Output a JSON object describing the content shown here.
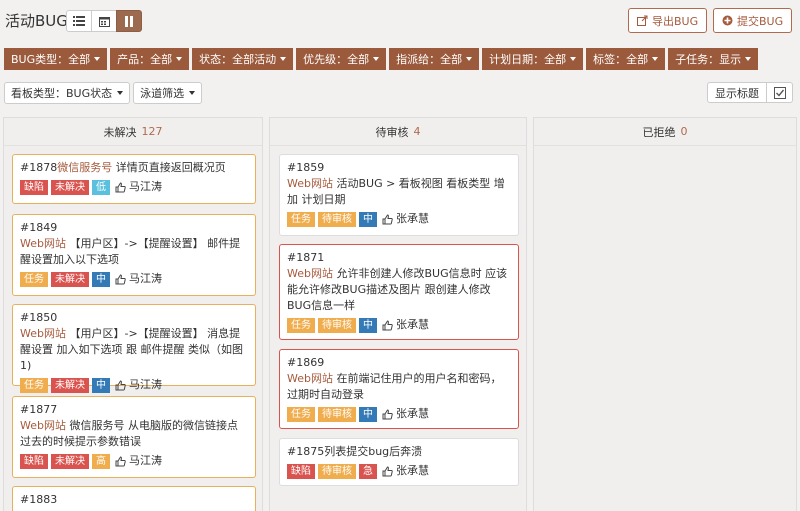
{
  "page": {
    "title": "活动BUG"
  },
  "header": {
    "export_label": "导出BUG",
    "submit_label": "提交BUG"
  },
  "filters": [
    "BUG类型：全部",
    "产品：全部",
    "状态：全部活动",
    "优先级：全部",
    "指派给：全部",
    "计划日期：全部",
    "标签：全部",
    "子任务：显示"
  ],
  "subbar": {
    "board_type": "看板类型：BUG状态",
    "lane_filter": "泳道筛选",
    "show_title": "显示标题"
  },
  "columns": [
    {
      "title": "未解决",
      "count": "127",
      "cards": [
        {
          "id": "#1878",
          "product": "微信服务号",
          "text": " 详情页直接返回概况页",
          "tags": [
            {
              "t": "缺陷",
              "c": "t-bug"
            },
            {
              "t": "未解决",
              "c": "t-open"
            },
            {
              "t": "低",
              "c": "t-low"
            }
          ],
          "owner": "马江涛"
        },
        {
          "id": "#1849",
          "product": "Web网站",
          "text": " 【用户区】->【提醒设置】 邮件提醒设置加入以下选项",
          "tags": [
            {
              "t": "任务",
              "c": "t-task"
            },
            {
              "t": "未解决",
              "c": "t-open"
            },
            {
              "t": "中",
              "c": "t-mid"
            }
          ],
          "owner": "马江涛"
        },
        {
          "id": "#1850",
          "product": "Web网站",
          "text": " 【用户区】->【提醒设置】 消息提醒设置 加入如下选项 跟 邮件提醒 类似（如图1)",
          "tags": [
            {
              "t": "任务",
              "c": "t-task"
            },
            {
              "t": "未解决",
              "c": "t-open"
            },
            {
              "t": "中",
              "c": "t-mid"
            }
          ],
          "owner": "马江涛"
        },
        {
          "id": "#1877",
          "product": "Web网站",
          "text": " 微信服务号 从电脑版的微信链接点过去的时候提示参数错误",
          "tags": [
            {
              "t": "缺陷",
              "c": "t-bug"
            },
            {
              "t": "未解决",
              "c": "t-open"
            },
            {
              "t": "高",
              "c": "t-high"
            }
          ],
          "owner": "马江涛"
        },
        {
          "id": "#1883"
        }
      ]
    },
    {
      "title": "待审核",
      "count": "4",
      "cards": [
        {
          "id": "#1859",
          "product": "Web网站",
          "text": " 活动BUG > 看板视图 看板类型 增加 计划日期",
          "tags": [
            {
              "t": "任务",
              "c": "t-task"
            },
            {
              "t": "待审核",
              "c": "t-review"
            },
            {
              "t": "中",
              "c": "t-mid"
            }
          ],
          "owner": "张承慧"
        },
        {
          "id": "#1871",
          "product": "Web网站",
          "text": " 允许非创建人修改BUG信息时 应该能允许修改BUG描述及图片 跟创建人修改BUG信息一样",
          "tags": [
            {
              "t": "任务",
              "c": "t-task"
            },
            {
              "t": "待审核",
              "c": "t-review"
            },
            {
              "t": "中",
              "c": "t-mid"
            }
          ],
          "owner": "张承慧"
        },
        {
          "id": "#1869",
          "product": "Web网站",
          "text": " 在前端记住用户的用户名和密码，过期时自动登录",
          "tags": [
            {
              "t": "任务",
              "c": "t-task"
            },
            {
              "t": "待审核",
              "c": "t-review"
            },
            {
              "t": "中",
              "c": "t-mid"
            }
          ],
          "owner": "张承慧"
        },
        {
          "id": "#1875列表提交bug后奔溃",
          "tags": [
            {
              "t": "缺陷",
              "c": "t-bug"
            },
            {
              "t": "待审核",
              "c": "t-review"
            },
            {
              "t": "急",
              "c": "t-urgent"
            }
          ],
          "owner": "张承慧"
        }
      ]
    },
    {
      "title": "已拒绝",
      "count": "0",
      "cards": []
    }
  ],
  "colors": {
    "accent": "#9b5a3c",
    "link": "#a65a3c"
  }
}
